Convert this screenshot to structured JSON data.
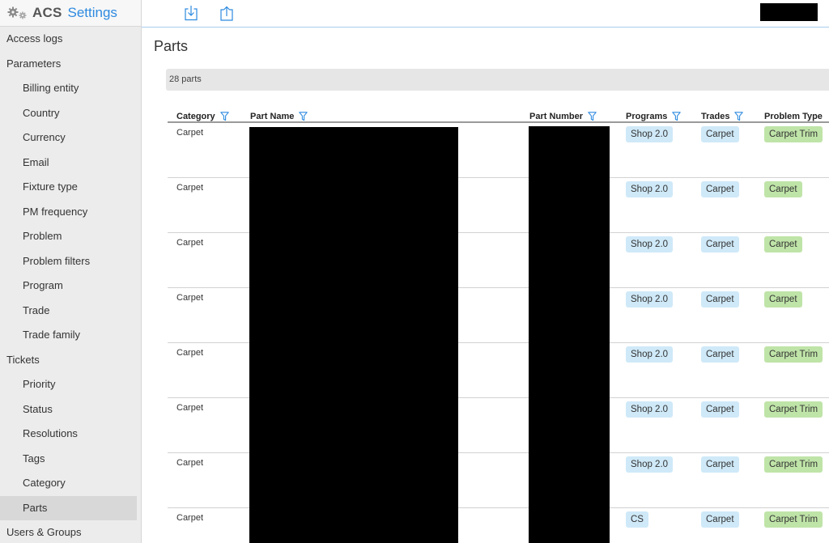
{
  "brand": {
    "acs": "ACS",
    "settings": "Settings"
  },
  "sidebar": {
    "items": [
      {
        "label": "Access logs",
        "level": "top",
        "active": false
      },
      {
        "label": "Parameters",
        "level": "top",
        "active": false
      },
      {
        "label": "Billing entity",
        "level": "sub",
        "active": false
      },
      {
        "label": "Country",
        "level": "sub",
        "active": false
      },
      {
        "label": "Currency",
        "level": "sub",
        "active": false
      },
      {
        "label": "Email",
        "level": "sub",
        "active": false
      },
      {
        "label": "Fixture type",
        "level": "sub",
        "active": false
      },
      {
        "label": "PM frequency",
        "level": "sub",
        "active": false
      },
      {
        "label": "Problem",
        "level": "sub",
        "active": false
      },
      {
        "label": "Problem filters",
        "level": "sub",
        "active": false
      },
      {
        "label": "Program",
        "level": "sub",
        "active": false
      },
      {
        "label": "Trade",
        "level": "sub",
        "active": false
      },
      {
        "label": "Trade family",
        "level": "sub",
        "active": false
      },
      {
        "label": "Tickets",
        "level": "top",
        "active": false
      },
      {
        "label": "Priority",
        "level": "sub",
        "active": false
      },
      {
        "label": "Status",
        "level": "sub",
        "active": false
      },
      {
        "label": "Resolutions",
        "level": "sub",
        "active": false
      },
      {
        "label": "Tags",
        "level": "sub",
        "active": false
      },
      {
        "label": "Category",
        "level": "sub",
        "active": false
      },
      {
        "label": "Parts",
        "level": "sub",
        "active": true
      },
      {
        "label": "Users & Groups",
        "level": "top",
        "active": false
      }
    ]
  },
  "toolbar": {
    "download_icon": "download-icon",
    "upload_icon": "upload-icon"
  },
  "main": {
    "title": "Parts",
    "count": "28 parts",
    "columns": [
      {
        "label": "Category",
        "filter": true
      },
      {
        "label": "Part Name",
        "filter": true
      },
      {
        "label": "Part Number",
        "filter": true
      },
      {
        "label": "Programs",
        "filter": true
      },
      {
        "label": "Trades",
        "filter": true
      },
      {
        "label": "Problem Type",
        "filter": false
      }
    ],
    "rows": [
      {
        "category": "Carpet",
        "program": "Shop 2.0",
        "trade": "Carpet",
        "problem_type": "Carpet Trim"
      },
      {
        "category": "Carpet",
        "program": "Shop 2.0",
        "trade": "Carpet",
        "problem_type": "Carpet"
      },
      {
        "category": "Carpet",
        "program": "Shop 2.0",
        "trade": "Carpet",
        "problem_type": "Carpet"
      },
      {
        "category": "Carpet",
        "program": "Shop 2.0",
        "trade": "Carpet",
        "problem_type": "Carpet"
      },
      {
        "category": "Carpet",
        "program": "Shop 2.0",
        "trade": "Carpet",
        "problem_type": "Carpet Trim"
      },
      {
        "category": "Carpet",
        "program": "Shop 2.0",
        "trade": "Carpet",
        "problem_type": "Carpet Trim"
      },
      {
        "category": "Carpet",
        "program": "Shop 2.0",
        "trade": "Carpet",
        "problem_type": "Carpet Trim"
      },
      {
        "category": "Carpet",
        "program": "CS",
        "trade": "Carpet",
        "problem_type": "Carpet Trim"
      }
    ]
  },
  "colors": {
    "accent": "#2d8ae0",
    "tag_blue": "#cfe9f8",
    "tag_green": "#bfe4a8"
  }
}
